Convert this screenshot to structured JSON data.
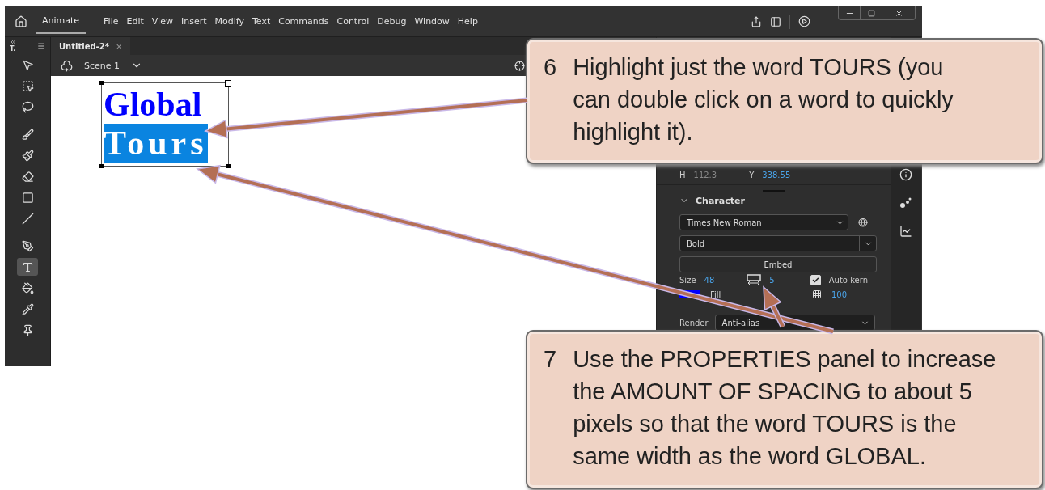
{
  "menu_bar": {
    "workspace": "Animate",
    "items": [
      "File",
      "Edit",
      "View",
      "Insert",
      "Modify",
      "Text",
      "Commands",
      "Control",
      "Debug",
      "Window",
      "Help"
    ]
  },
  "tools_header": "T.",
  "tools": [
    {
      "kind": "selection",
      "selected": false
    },
    {
      "kind": "transform",
      "selected": false
    },
    {
      "kind": "lasso",
      "selected": false
    },
    {
      "kind": "brush",
      "selected": false
    },
    {
      "kind": "paintbrush",
      "selected": false
    },
    {
      "kind": "eraser",
      "selected": false
    },
    {
      "kind": "rectangle",
      "selected": false
    },
    {
      "kind": "line",
      "selected": false
    },
    {
      "kind": "pen",
      "selected": false
    },
    {
      "kind": "text",
      "selected": true
    },
    {
      "kind": "bucket",
      "selected": false
    },
    {
      "kind": "eyedropper",
      "selected": false
    },
    {
      "kind": "pin",
      "selected": false
    }
  ],
  "document_tab": {
    "title": "Untitled-2*",
    "close": "×"
  },
  "scene": {
    "label": "Scene 1"
  },
  "stage": {
    "lines": [
      {
        "text": "Global",
        "highlighted": false
      },
      {
        "text": "Tours",
        "highlighted": true
      }
    ]
  },
  "properties": {
    "h_label": "H",
    "h_value": "112.3",
    "y_label": "Y",
    "y_value": "338.55",
    "section": {
      "title": "Character",
      "expanded": true
    },
    "font_family": "Times New Roman",
    "font_style": "Bold",
    "embed_button": "Embed",
    "size_label": "Size",
    "size_value": "48",
    "tracking_value": "5",
    "auto_kern": {
      "label": "Auto kern",
      "checked": true
    },
    "fill": {
      "label": "Fill",
      "color": "#0000ff"
    },
    "alpha_value": "100",
    "render_label": "Render",
    "render_value": "Anti-alias"
  },
  "callouts": [
    {
      "number": "6",
      "text": "Highlight just the word TOURS (you can double click on a word to quickly highlight it)."
    },
    {
      "number": "7",
      "text": "Use the PROPERTIES panel to increase the AMOUNT OF SPACING to about 5 pixels so that the word TOURS is the same width as the word GLOBAL."
    }
  ]
}
